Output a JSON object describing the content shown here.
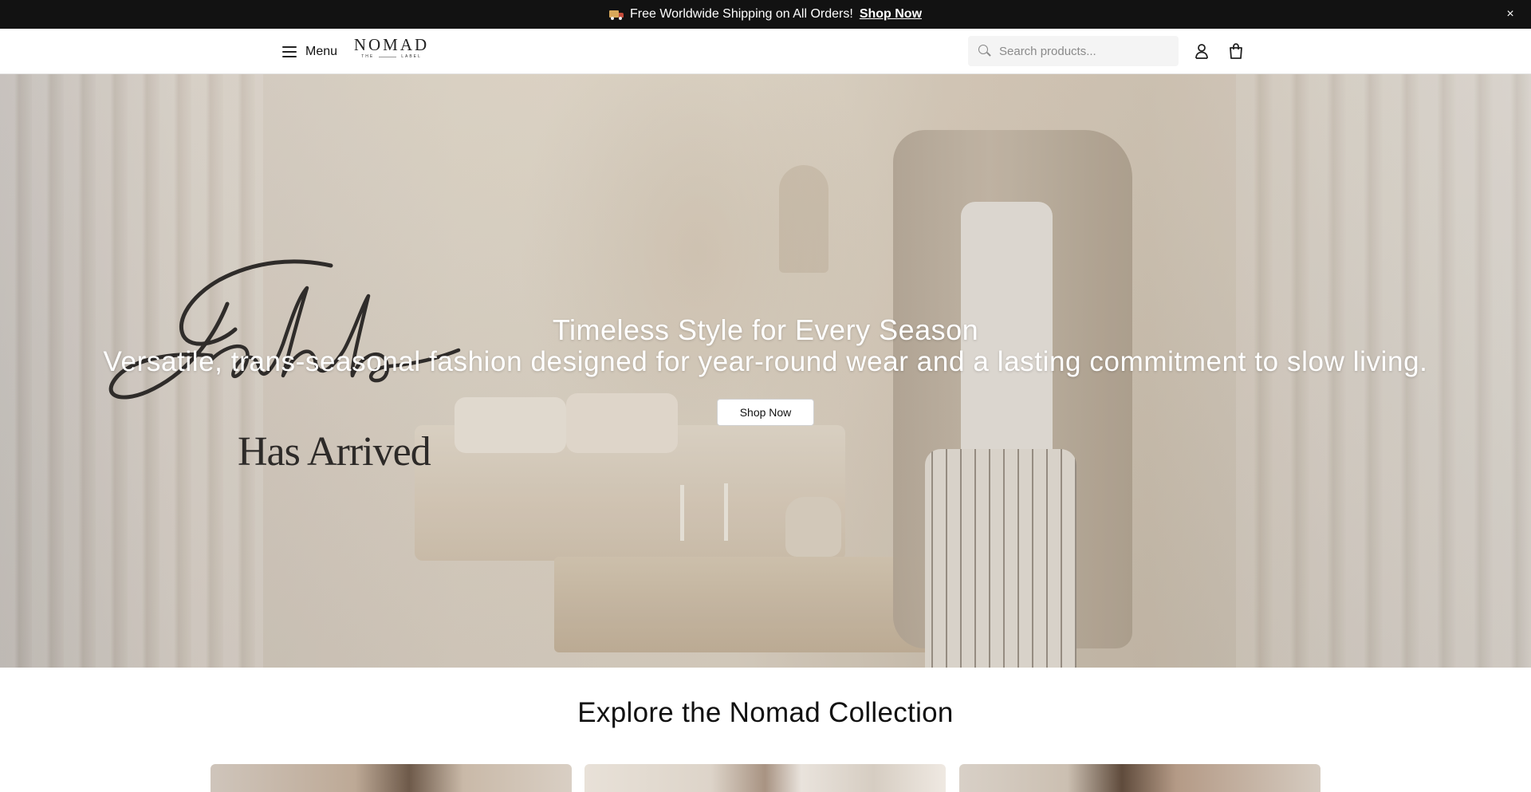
{
  "announcement": {
    "text": "Free Worldwide Shipping on All Orders!",
    "link": "Shop Now",
    "icon": "delivery-truck-icon",
    "close": "×"
  },
  "header": {
    "menu_label": "Menu",
    "logo": {
      "word": "NOMAD",
      "sub_left": "THE",
      "sub_right": "LABEL"
    },
    "search": {
      "placeholder": "Search products...",
      "value": ""
    },
    "icons": [
      "hamburger-icon",
      "search-icon",
      "user-icon",
      "shopping-bag-icon"
    ]
  },
  "hero": {
    "title": "Timeless Style for Every Season",
    "subtitle": "Versatile, trans-seasonal fashion designed for year-round wear and a lasting commitment to slow living.",
    "button": "Shop Now",
    "campaign_script": "Sakha",
    "campaign_sub": "Has Arrived"
  },
  "collection": {
    "title": "Explore the Nomad Collection",
    "cards": [
      "collection-card-1",
      "collection-card-2",
      "collection-card-3"
    ]
  },
  "colors": {
    "announcement_bg": "#121212",
    "announcement_text": "#ffffff",
    "search_bg": "#f4f4f4",
    "hero_text": "#ffffff",
    "button_bg": "#ffffff"
  }
}
